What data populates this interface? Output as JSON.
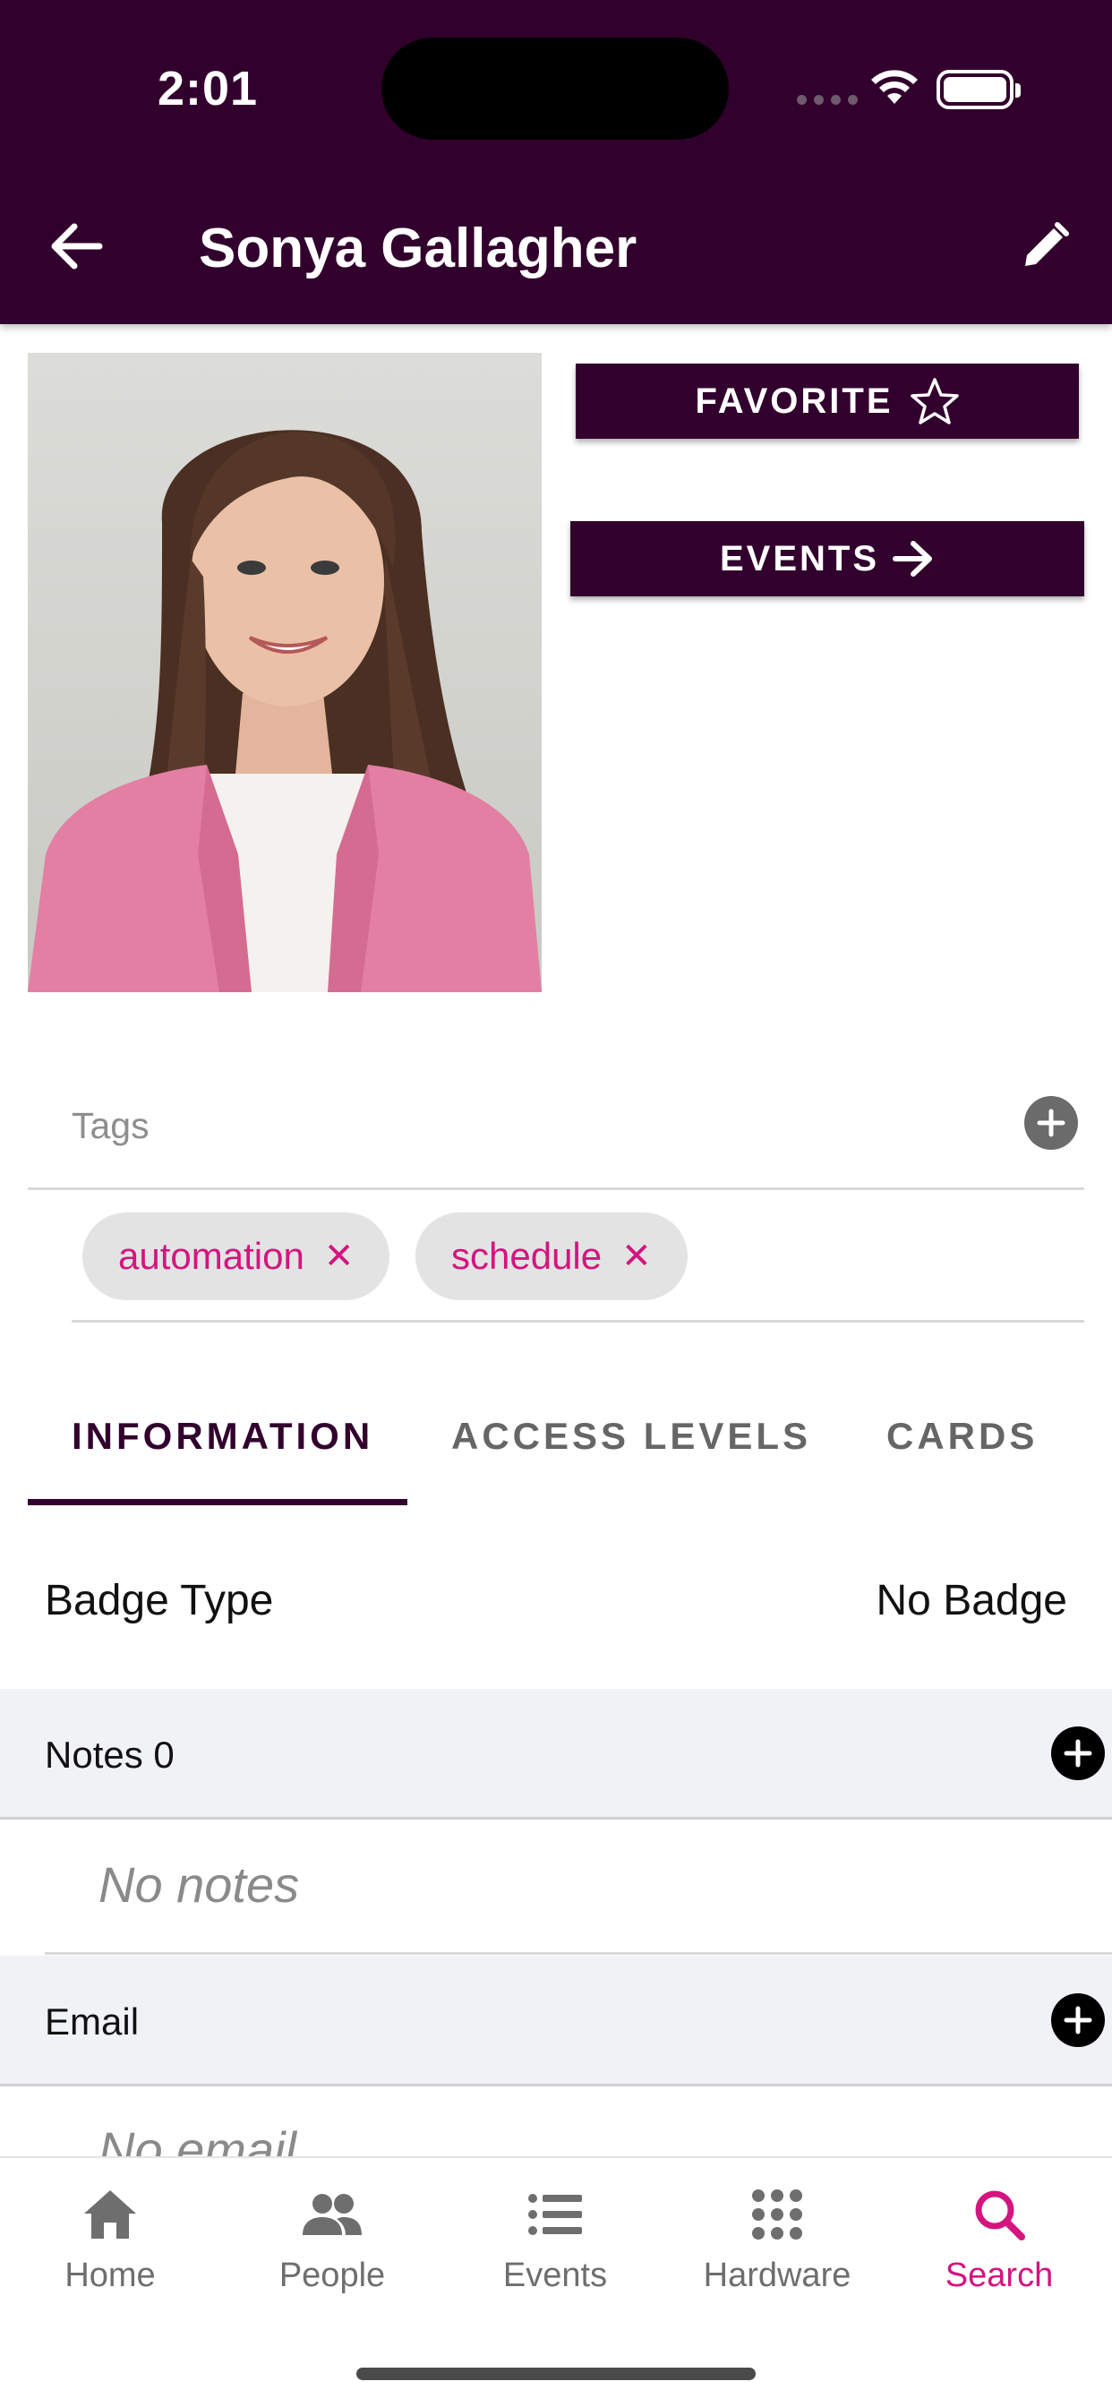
{
  "status_bar": {
    "time": "2:01"
  },
  "header": {
    "title": "Sonya Gallagher"
  },
  "actions": {
    "favorite_label": "FAVORITE",
    "events_label": "EVENTS"
  },
  "tags": {
    "label": "Tags",
    "items": [
      {
        "label": "automation"
      },
      {
        "label": "schedule"
      }
    ]
  },
  "tabs": [
    {
      "label": "INFORMATION",
      "active": true
    },
    {
      "label": "ACCESS LEVELS"
    },
    {
      "label": "CARDS"
    }
  ],
  "information": {
    "badge_type_label": "Badge Type",
    "badge_type_value": "No Badge"
  },
  "notes": {
    "label": "Notes 0",
    "empty": "No notes"
  },
  "email": {
    "label": "Email",
    "empty": "No email"
  },
  "bottom_nav": [
    {
      "label": "Home",
      "icon": "home-icon"
    },
    {
      "label": "People",
      "icon": "people-icon"
    },
    {
      "label": "Events",
      "icon": "list-icon"
    },
    {
      "label": "Hardware",
      "icon": "grid-icon"
    },
    {
      "label": "Search",
      "icon": "search-icon",
      "active": true
    }
  ],
  "colors": {
    "brand": "#32002d",
    "accent": "#d4147f",
    "chip_bg": "#e3e3e3",
    "section_bg": "#f1f2f6"
  }
}
